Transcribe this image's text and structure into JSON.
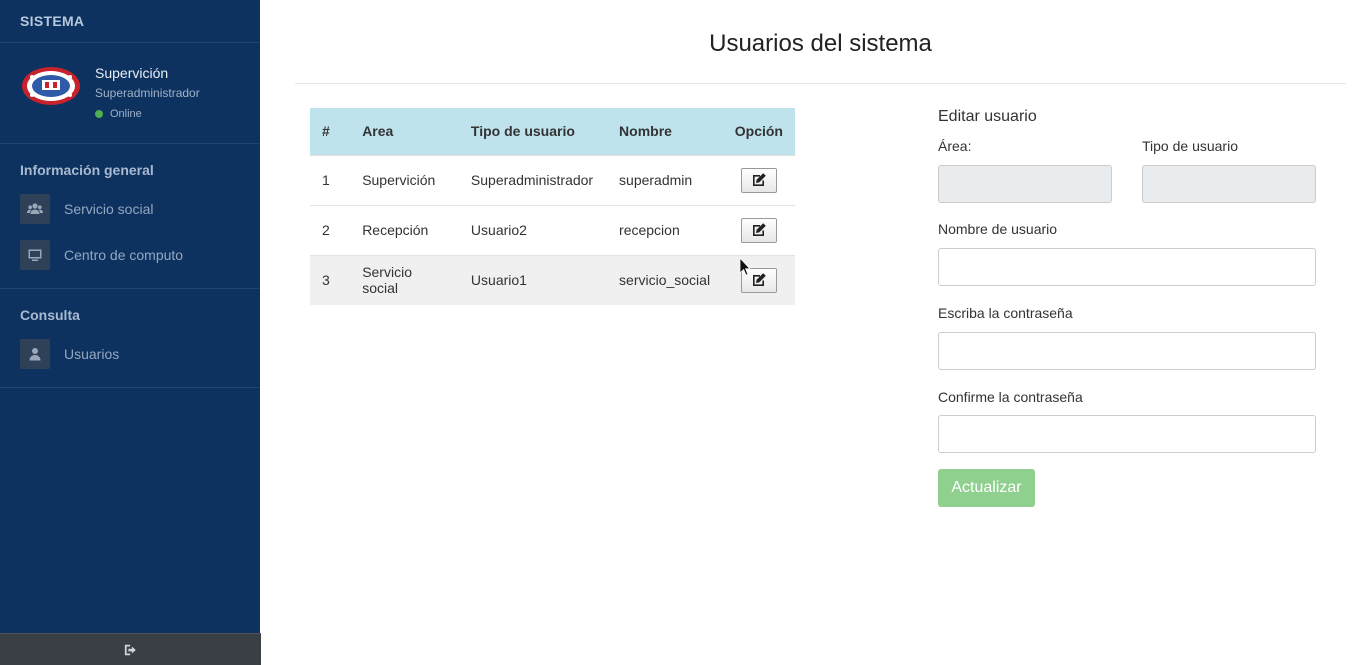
{
  "sidebar": {
    "brand": "SISTEMA",
    "user": {
      "name": "Supervición",
      "role": "Superadministrador",
      "status": "Online"
    },
    "sections": [
      {
        "title": "Información general",
        "items": [
          {
            "label": "Servicio social",
            "icon": "users-icon"
          },
          {
            "label": "Centro de computo",
            "icon": "desktop-icon"
          }
        ]
      },
      {
        "title": "Consulta",
        "items": [
          {
            "label": "Usuarios",
            "icon": "user-icon"
          }
        ]
      }
    ],
    "footer_icon": "sign-out-icon"
  },
  "main": {
    "title": "Usuarios del sistema",
    "table": {
      "headers": [
        "#",
        "Area",
        "Tipo de usuario",
        "Nombre",
        "Opción"
      ],
      "rows": [
        [
          "1",
          "Supervición",
          "Superadministrador",
          "superadmin"
        ],
        [
          "2",
          "Recepción",
          "Usuario2",
          "recepcion"
        ],
        [
          "3",
          "Servicio social",
          "Usuario1",
          "servicio_social"
        ]
      ],
      "option_icon": "edit-icon"
    },
    "form": {
      "title": "Editar usuario",
      "area_label": "Área:",
      "area_value": "",
      "type_label": "Tipo de usuario",
      "type_value": "",
      "username_label": "Nombre de usuario",
      "username_value": "",
      "password_label": "Escriba la contraseña",
      "password_value": "",
      "confirm_label": "Confirme la contraseña",
      "confirm_value": "",
      "submit_label": "Actualizar"
    },
    "colors": {
      "sidebar_bg": "#0d3260",
      "table_header_bg": "#bfe3ec",
      "button_bg": "#8fd08f"
    }
  }
}
